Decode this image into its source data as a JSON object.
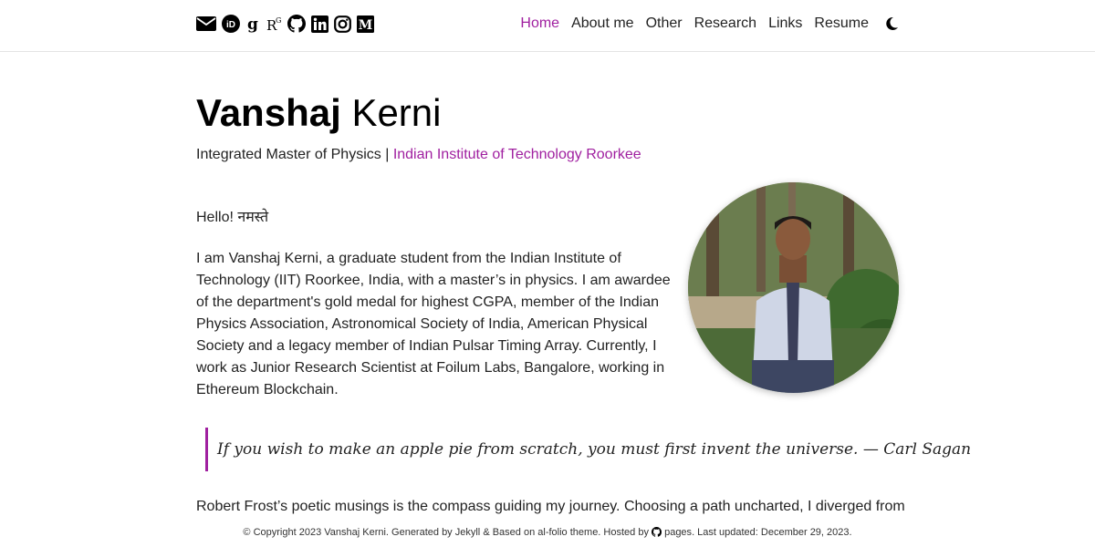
{
  "nav": {
    "items": [
      {
        "label": "Home",
        "active": true
      },
      {
        "label": "About me"
      },
      {
        "label": "Other"
      },
      {
        "label": "Research"
      },
      {
        "label": "Links"
      },
      {
        "label": "Resume"
      }
    ],
    "social_icons": [
      "envelope-icon",
      "orcid-icon",
      "google-scholar-icon",
      "researchgate-icon",
      "github-icon",
      "linkedin-icon",
      "instagram-icon",
      "medium-icon"
    ],
    "theme_icon": "moon-icon",
    "accent_color": "#a020a0"
  },
  "header": {
    "first_name": "Vanshaj",
    "last_name": "Kerni",
    "subtitle_prefix": "Integrated Master of Physics |",
    "institute": "Indian Institute of Technology Roorkee"
  },
  "content": {
    "greeting": "Hello! नमस्ते",
    "bio": "I am Vanshaj Kerni, a graduate student from the Indian Institute of Technology (IIT) Roorkee, India, with a master’s in physics. I am awardee of the department's gold medal for highest CGPA, member of the Indian Physics Association, Astronomical Society of India, American Physical Society and a legacy member of Indian Pulsar Timing Array. Currently, I work as Junior Research Scientist at Foilum Labs, Bangalore, working in Ethereum Blockchain.",
    "quote": "If you wish to make an apple pie from scratch, you must first invent the universe. — Carl Sagan",
    "frost": "Robert Frost’s poetic musings is the compass guiding my journey. Choosing a path uncharted, I diverged from"
  },
  "footer": {
    "text_before": "© Copyright 2023 Vanshaj Kerni. Generated by",
    "jekyll": "Jekyll",
    "text_middle": "& Based on",
    "theme": "al-folio",
    "text_hosted": "theme. Hosted by",
    "pages": "pages",
    "updated": ". Last updated: December 29, 2023."
  }
}
